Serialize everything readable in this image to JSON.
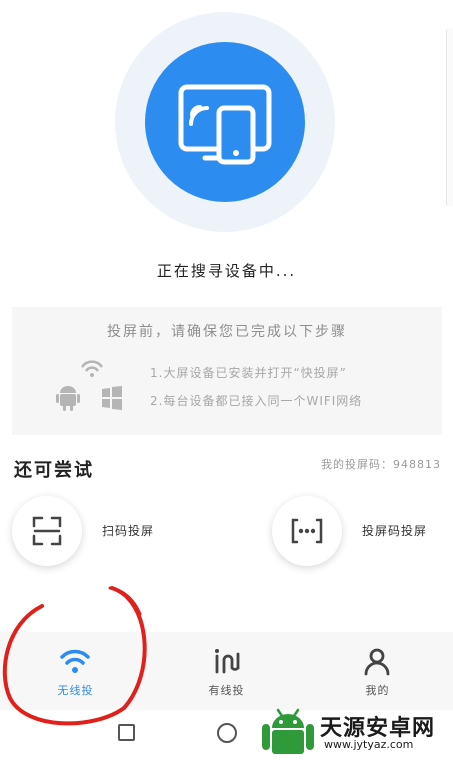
{
  "status": {
    "searching": "正在搜寻设备中..."
  },
  "steps": {
    "title": "投屏前，请确保您已完成以下步骤",
    "items": [
      "1.大屏设备已安装并打开“快投屏”",
      "2.每台设备都已接入同一个WIFI网络"
    ]
  },
  "try_section": {
    "title": "还可尝试",
    "my_code": "我的投屏码：948813",
    "options": [
      {
        "label": "扫码投屏",
        "icon": "scan-icon"
      },
      {
        "label": "投屏码投屏",
        "icon": "code-icon"
      }
    ]
  },
  "tabs": [
    {
      "label": "无线投",
      "icon": "wifi-icon",
      "active": true
    },
    {
      "label": "有线投",
      "icon": "cable-icon",
      "active": false
    },
    {
      "label": "我的",
      "icon": "profile-icon",
      "active": false
    }
  ],
  "watermark": {
    "title": "天源安卓网",
    "url": "www.jytyaz.com"
  },
  "colors": {
    "accent": "#2d8cf0",
    "highlight": "#e0201b",
    "watermark_green": "#2f9a3a"
  }
}
